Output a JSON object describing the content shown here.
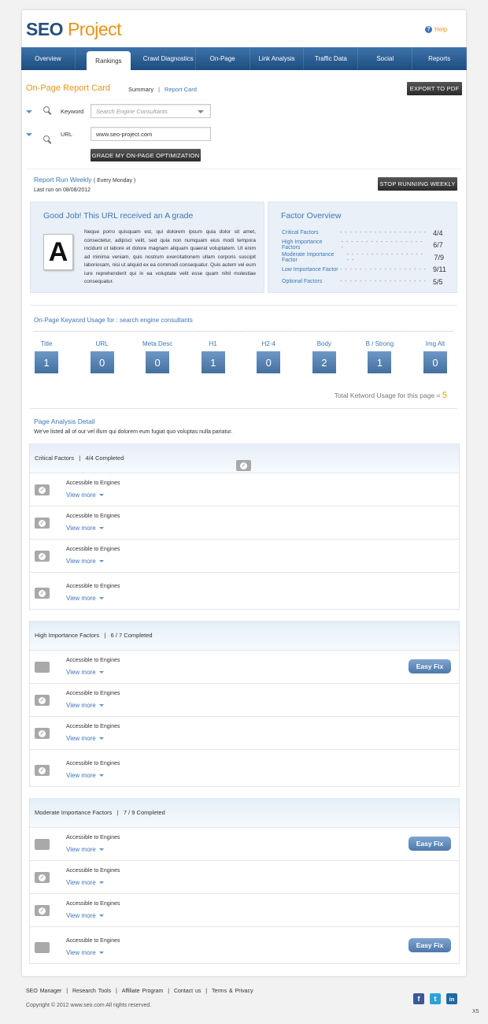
{
  "logo": {
    "part1": "SEO",
    "part2": " Project"
  },
  "help": {
    "icon": "help-icon",
    "label": "Help"
  },
  "nav": {
    "tabs": [
      "Overview",
      "Rankings",
      "Crawl Diagnostics",
      "On-Page",
      "Link Analysis",
      "Traffic Data",
      "Social",
      "Reports"
    ]
  },
  "report": {
    "title": "On-Page Report Card",
    "summary": "Summary",
    "separator": "|",
    "report_card": "Report Card",
    "export": "EXPORT TO PDF",
    "keyword_label": "Keyword",
    "keyword_placeholder": "Search Engine Consultants",
    "url_label": "URL",
    "url_value": "www.seo-project.com",
    "grade_button": "GRADE MY ON-PAGE OPTIMIZATION"
  },
  "run": {
    "link": "Report Run Weekly",
    "freq": "( Every Monday )",
    "last_run": "Last run on 08/08/2012",
    "stop_button": "STOP RUNNIING WEEKLY"
  },
  "grade": {
    "heading": "Good Job! This URL received an A grade",
    "letter": "A",
    "text": "Neque porro quisquam est, qui dolorem ipsum quia dolor sit amet, consectetur, adipisci velit, sed quia non numquam eius modi tempora incidunt ut labore et dolore magnam aliquam quaerat voluptatem. Ut enim ad minima veniam, quis nostrum exercitationem ullam corporis suscipit laboriosam, nisi ut aliquid ex ea commodi consequatur. Quis autem vel eum iure reprehenderit qui in ea voluptate velit esse quam nihil molestiae consequatur."
  },
  "factor_overview": {
    "heading": "Factor Overview",
    "dots": "- - - - - - - - - - - - - - - - - -",
    "rows": [
      {
        "label": "Critical Factors",
        "value": "4/4"
      },
      {
        "label": "High Importance Factors",
        "value": "6/7"
      },
      {
        "label": "Moderate Importance Factor",
        "value": "7/9"
      },
      {
        "label": "Low Importance Factor",
        "value": "9/11"
      },
      {
        "label": "Optional Factors",
        "value": "5/5"
      }
    ]
  },
  "keyword_usage": {
    "heading": "On-Page Keyword Usage for : search engine consultants",
    "items": [
      {
        "label": "Title",
        "value": "1"
      },
      {
        "label": "URL",
        "value": "0"
      },
      {
        "label": "Meta Desc",
        "value": "0"
      },
      {
        "label": "H1",
        "value": "1"
      },
      {
        "label": "H2-4",
        "value": "0"
      },
      {
        "label": "Body",
        "value": "2"
      },
      {
        "label": "B / Strong",
        "value": "1"
      },
      {
        "label": "Img Alt",
        "value": "0"
      }
    ],
    "total_label": "Total Ketword Usage for this page =",
    "total_value": "5"
  },
  "analysis": {
    "heading": "Page Analysis Detail",
    "sub": "We've listed all of our vel illum qui dolorem eum fugiat quo voluptas nulla pariatur."
  },
  "sections": [
    {
      "name": "Critical Factors",
      "sep": "|",
      "status": "4/4 Completed",
      "items": [
        {
          "title": "Accessible to Engines",
          "view": "View more",
          "checked": true
        },
        {
          "title": "Accessible to Engines",
          "view": "View more",
          "checked": true
        },
        {
          "title": "Accessible to Engines",
          "view": "View more",
          "checked": true
        },
        {
          "title": "Accessible to Engines",
          "view": "View more",
          "checked": true
        }
      ]
    },
    {
      "name": "High Importance Factors",
      "sep": "|",
      "status": "6 / 7 Completed",
      "items": [
        {
          "title": "Accessible to Engines",
          "view": "View more",
          "checked": false,
          "fix": "Easy Fix"
        },
        {
          "title": "Accessible to Engines",
          "view": "View more",
          "checked": true
        },
        {
          "title": "Accessible to Engines",
          "view": "View more",
          "checked": true
        },
        {
          "title": "Accessible to Engines",
          "view": "View more",
          "checked": true
        }
      ]
    },
    {
      "name": "Moderate Importance Factors",
      "sep": "|",
      "status": "7 / 9 Completed",
      "items": [
        {
          "title": "Accessible to Engines",
          "view": "View more",
          "checked": false,
          "fix": "Easy Fix"
        },
        {
          "title": "Accessible to Engines",
          "view": "View more",
          "checked": true
        },
        {
          "title": "Accessible to Engines",
          "view": "View more",
          "checked": true
        },
        {
          "title": "Accessible to Engines",
          "view": "View more",
          "checked": false,
          "fix": "Easy Fix"
        }
      ]
    }
  ],
  "footer": {
    "links": [
      "SEO Manager",
      "Research Tools",
      "Affiliate Program",
      "Contact us",
      "Terms & Privacy"
    ],
    "sep": "|",
    "copyright": "Copyright © 2012 www.seo.com   All rights reserved.",
    "social": [
      {
        "icon": "facebook-icon",
        "glyph": "f",
        "color": "#3b5998"
      },
      {
        "icon": "twitter-icon",
        "glyph": "t",
        "color": "#2aa3d8"
      },
      {
        "icon": "linkedin-icon",
        "glyph": "in",
        "color": "#1f6aa5"
      }
    ],
    "corner": "X5"
  }
}
